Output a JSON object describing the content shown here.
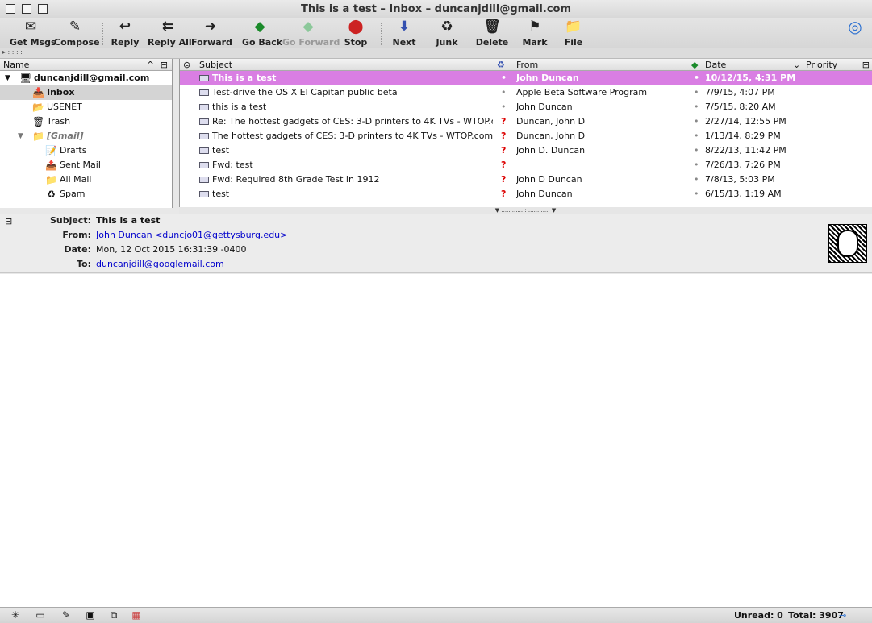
{
  "window": {
    "title": "This is a test – Inbox – duncanjdill@gmail.com"
  },
  "toolbar": {
    "get_msgs": "Get Msgs",
    "compose": "Compose",
    "reply": "Reply",
    "reply_all": "Reply All",
    "forward": "Forward",
    "go_back": "Go Back",
    "go_forward": "Go Forward",
    "stop": "Stop",
    "next": "Next",
    "junk": "Junk",
    "delete": "Delete",
    "mark": "Mark",
    "file": "File"
  },
  "folder_pane": {
    "header": "Name",
    "account": "duncanjdill@gmail.com",
    "folders": [
      {
        "label": "Inbox",
        "icon": "inbox-icon"
      },
      {
        "label": "USENET",
        "icon": "folder-icon"
      },
      {
        "label": "Trash",
        "icon": "trash-icon"
      },
      {
        "label": "[Gmail]",
        "icon": "folder-icon"
      },
      {
        "label": "Drafts",
        "icon": "drafts-icon"
      },
      {
        "label": "Sent Mail",
        "icon": "sent-icon"
      },
      {
        "label": "All Mail",
        "icon": "folder-icon"
      },
      {
        "label": "Spam",
        "icon": "spam-icon"
      }
    ]
  },
  "message_list": {
    "columns": {
      "subject": "Subject",
      "from": "From",
      "date": "Date",
      "priority": "Priority"
    },
    "rows": [
      {
        "subject": "This is a test",
        "from": "John Duncan",
        "date": "10/12/15, 4:31 PM",
        "junk": false
      },
      {
        "subject": "Test-drive the OS X El Capitan public beta",
        "from": "Apple Beta Software Program",
        "date": "7/9/15, 4:07 PM",
        "junk": false
      },
      {
        "subject": "this is a test",
        "from": "John Duncan",
        "date": "7/5/15, 8:20 AM",
        "junk": false
      },
      {
        "subject": "Re: The hottest gadgets of CES: 3-D printers to 4K TVs - WTOP.com",
        "from": "Duncan, John D",
        "date": "2/27/14, 12:55 PM",
        "junk": true
      },
      {
        "subject": "The hottest gadgets of CES: 3-D printers to 4K TVs - WTOP.com",
        "from": "Duncan, John D",
        "date": "1/13/14, 8:29 PM",
        "junk": true
      },
      {
        "subject": "test",
        "from": "John D. Duncan",
        "date": "8/22/13, 11:42 PM",
        "junk": true
      },
      {
        "subject": "Fwd: test",
        "from": "",
        "date": "7/26/13, 7:26 PM",
        "junk": true
      },
      {
        "subject": "Fwd: Required 8th Grade Test in 1912",
        "from": "John D Duncan",
        "date": "7/8/13, 5:03 PM",
        "junk": true
      },
      {
        "subject": "test",
        "from": "John Duncan",
        "date": "6/15/13, 1:19 AM",
        "junk": true
      }
    ]
  },
  "message_header": {
    "subject_label": "Subject:",
    "subject": "This is a test",
    "from_label": "From:",
    "from": "John Duncan <duncjo01@gettysburg.edu>",
    "date_label": "Date:",
    "date": "Mon, 12 Oct 2015 16:31:39 -0400",
    "to_label": "To:",
    "to": "duncanjdill@googlemail.com"
  },
  "status": {
    "unread": "Unread: 0",
    "total": "Total: 3907"
  },
  "colors": {
    "selection": "#d97ee3",
    "link": "#0000cc",
    "junk": "#dd0000"
  }
}
